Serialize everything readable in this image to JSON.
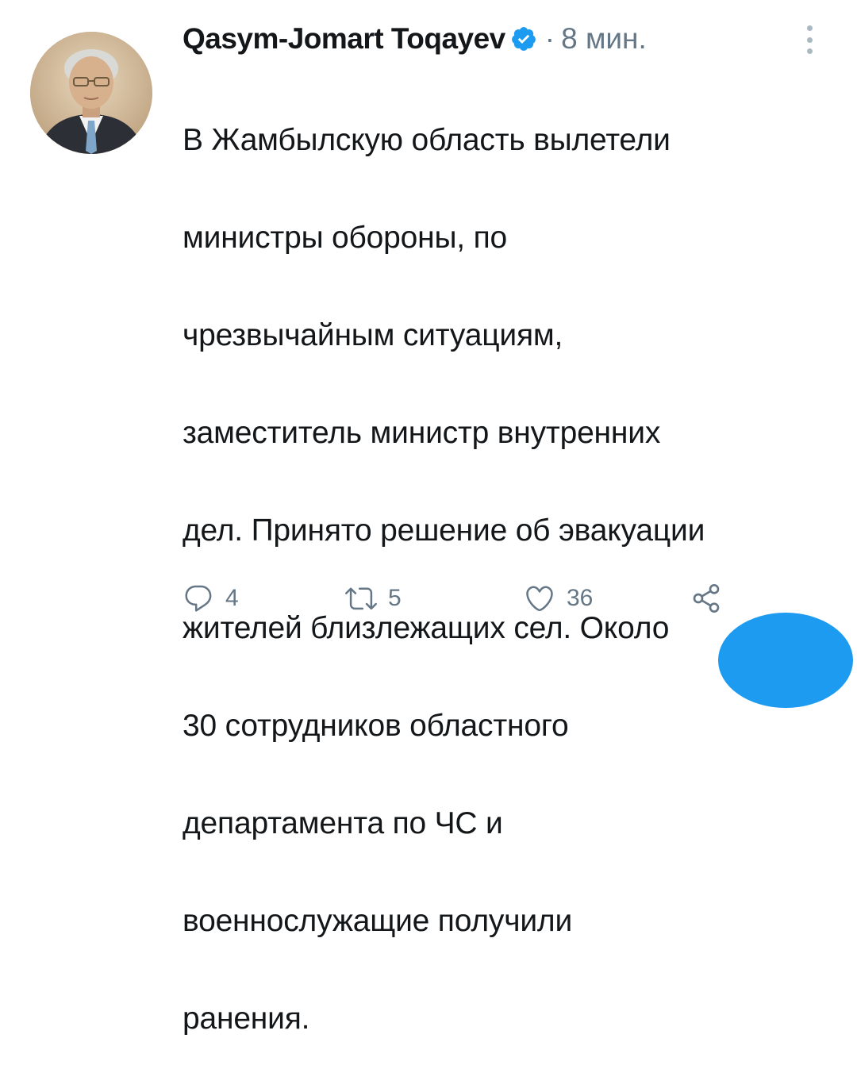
{
  "tweet": {
    "author_name": "Qasym-Jomart Toqayev",
    "separator": "·",
    "time": "8 мин.",
    "text_lines": [
      "В  Жамбылскую область вылетели",
      "министры обороны, по",
      "чрезвычайным ситуациям,",
      "заместитель министр внутренних",
      "дел. Принято решение об эвакуации",
      "жителей близлежащих сел. Около",
      "30 сотрудников областного",
      "департамента по ЧС и",
      "военнослужащие получили",
      "ранения."
    ],
    "verified": true
  },
  "actions": {
    "reply_count": "4",
    "retweet_count": "5",
    "like_count": "36"
  },
  "icons": {
    "verified": "verified-badge-icon",
    "more": "more-vertical-icon",
    "reply": "comment-icon",
    "retweet": "retweet-icon",
    "like": "heart-icon",
    "share": "share-icon"
  },
  "colors": {
    "accent": "#1d9bf0",
    "text": "#14171a",
    "secondary": "#657786"
  }
}
